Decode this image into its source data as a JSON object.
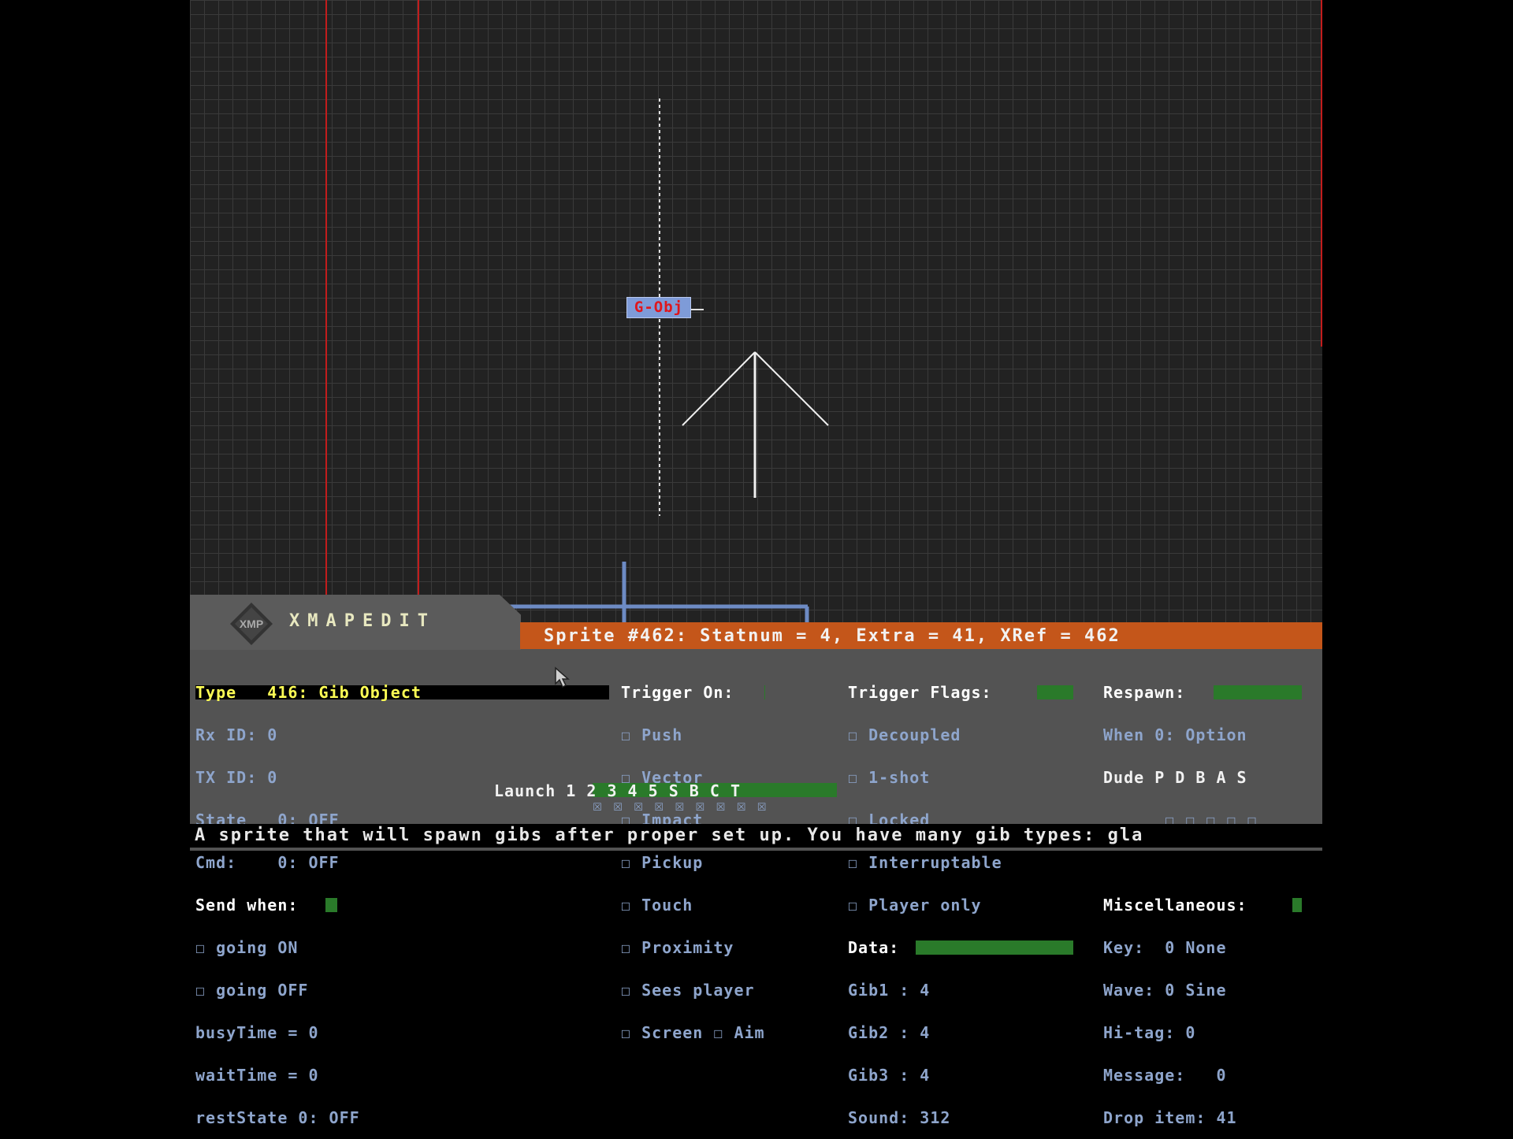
{
  "app": {
    "title": "XMAPEDIT"
  },
  "map": {
    "sprite_label": "G-Obj"
  },
  "sprite_header": "Sprite #462: Statnum = 4, Extra = 41, XRef = 462",
  "col1": {
    "type": "Type   416: Gib Object",
    "rx": "Rx ID: 0",
    "tx": "TX ID: 0",
    "state": "State   0: OFF",
    "cmd": "Cmd:    0: OFF",
    "send_when": "Send when:",
    "going_on": "☐ going ON",
    "going_off": "☐ going OFF",
    "busy": "busyTime = 0",
    "wait": "waitTime = 0",
    "rest": "restState 0: OFF"
  },
  "col2": {
    "header": "Trigger On:",
    "items": [
      "☐ Push",
      "☐ Vector",
      "☐ Impact",
      "☐ Pickup",
      "☐ Touch",
      "☐ Proximity",
      "☐ Sees player",
      "☐ Screen ☐ Aim"
    ]
  },
  "launch": {
    "label": "Launch 1 2 3 4 5 S B C T",
    "boxes": "☒ ☒ ☒ ☒ ☒ ☒ ☒ ☒ ☒"
  },
  "col3": {
    "header": "Trigger Flags:",
    "items": [
      "☐ Decoupled",
      "☐ 1-shot",
      "☐ Locked",
      "☐ Interruptable",
      "☐ Player only"
    ],
    "data_header": "Data:",
    "data": [
      "Gib1 : 4",
      "Gib2 : 4",
      "Gib3 : 4",
      "Sound: 312"
    ]
  },
  "col4": {
    "header": "Respawn:",
    "when": "When 0: Option",
    "dude": "Dude P D B A S",
    "dude_boxes": "      ☐ ☐ ☐ ☐ ☐",
    "misc_header": "Miscellaneous:",
    "misc": [
      "Key:  0 None",
      "Wave: 0 Sine",
      "Hi-tag: 0",
      "Message:   0",
      "Drop item: 41"
    ]
  },
  "status_text": "A sprite that will spawn gibs after proper set up. You have many gib types: gla",
  "colors": {
    "accent_orange": "#c4561a",
    "green_bar": "#2a7a2a",
    "grid_bg": "#222222",
    "red_line": "#c21c1c"
  }
}
